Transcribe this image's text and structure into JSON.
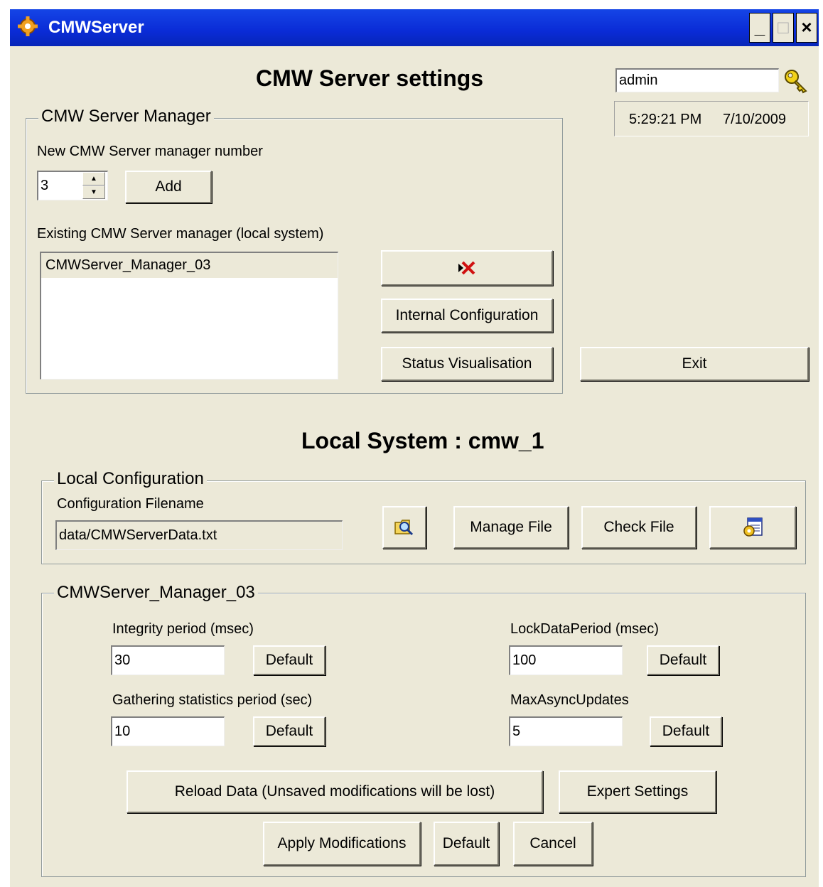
{
  "window": {
    "title": "CMWServer"
  },
  "header": {
    "title": "CMW Server settings"
  },
  "user": {
    "name": "admin",
    "time": "5:29:21 PM",
    "date": "7/10/2009"
  },
  "manager_group": {
    "legend": "CMW Server Manager",
    "new_label": "New CMW Server manager number",
    "number_value": "3",
    "add_label": "Add",
    "existing_label": "Existing CMW Server manager (local system)",
    "managers": [
      "CMWServer_Manager_03"
    ],
    "internal_config_label": "Internal Configuration",
    "status_vis_label": "Status Visualisation"
  },
  "exit_label": "Exit",
  "local_system_title": "Local System : cmw_1",
  "local_config": {
    "legend": "Local Configuration",
    "filename_label": "Configuration Filename",
    "filename_value": "data/CMWServerData.txt",
    "manage_file_label": "Manage File",
    "check_file_label": "Check File"
  },
  "manager_settings": {
    "legend": "CMWServer_Manager_03",
    "integrity_label": "Integrity period (msec)",
    "integrity_value": "30",
    "lockdata_label": "LockDataPeriod (msec)",
    "lockdata_value": "100",
    "gathering_label": "Gathering statistics period (sec)",
    "gathering_value": "10",
    "maxasync_label": "MaxAsyncUpdates",
    "maxasync_value": "5",
    "default_label": "Default",
    "reload_label": "Reload Data (Unsaved modifications will be lost)",
    "expert_label": "Expert Settings",
    "apply_label": "Apply Modifications",
    "cancel_label": "Cancel"
  }
}
